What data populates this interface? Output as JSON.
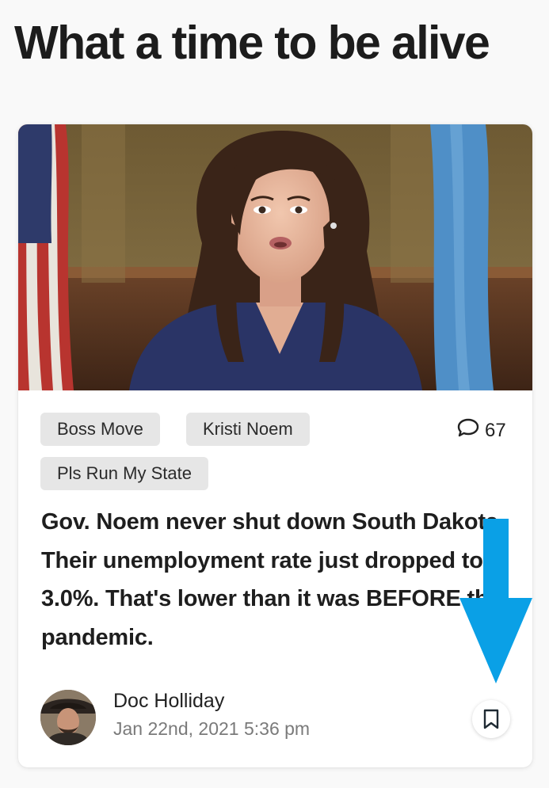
{
  "page": {
    "title": "What a time to be alive"
  },
  "post": {
    "image_alt": "Woman speaking in front of flags",
    "tags": [
      "Boss Move",
      "Kristi Noem",
      "Pls Run My State"
    ],
    "comment_icon": "speech-bubble-icon",
    "comment_count": "67",
    "headline": "Gov. Noem never shut down South Dakota. Their unemployment rate just dropped to 3.0%. That's lower than it was BEFORE the pandemic.",
    "author": {
      "name": "Doc Holliday",
      "date": "Jan 22nd, 2021 5:36 pm"
    },
    "bookmark_icon": "bookmark-icon"
  },
  "annotation": {
    "arrow_color": "#0aa0e6"
  }
}
